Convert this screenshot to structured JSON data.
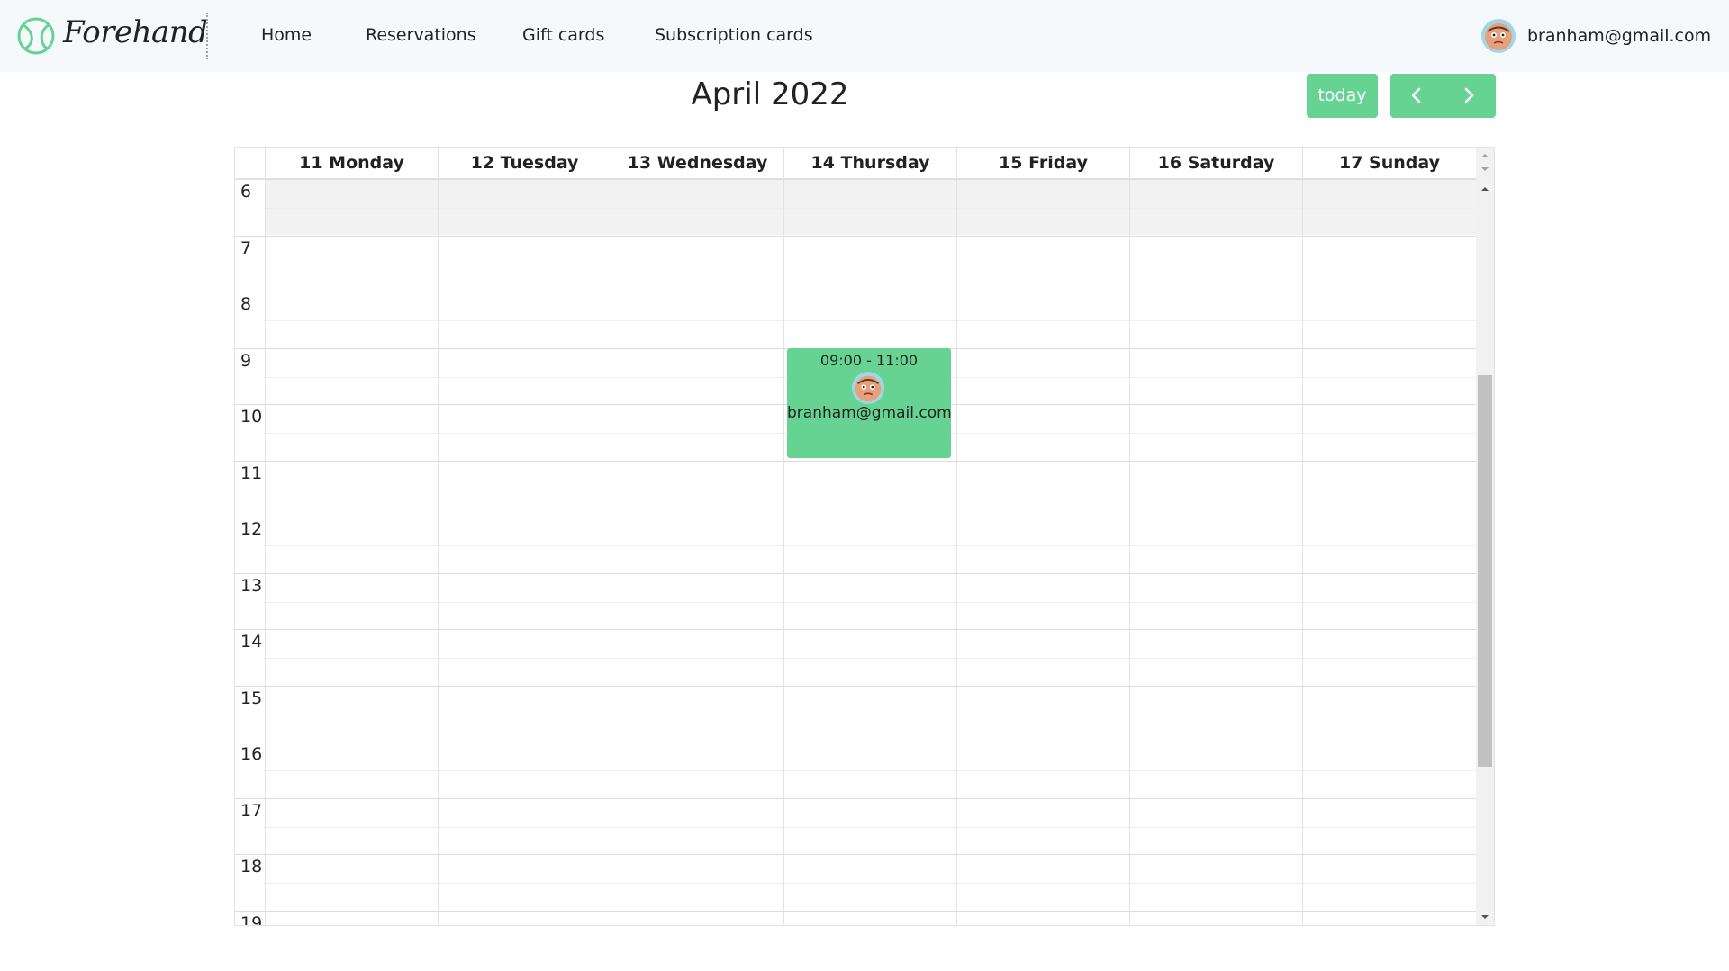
{
  "header": {
    "brand": "Forehand",
    "nav": [
      {
        "label": "Home"
      },
      {
        "label": "Reservations"
      },
      {
        "label": "Gift cards"
      },
      {
        "label": "Subscription cards"
      }
    ],
    "user_email": "branham@gmail.com"
  },
  "calendar": {
    "title": "April 2022",
    "today_label": "today",
    "days": [
      {
        "label": "11 Monday"
      },
      {
        "label": "12 Tuesday"
      },
      {
        "label": "13 Wednesday"
      },
      {
        "label": "14 Thursday"
      },
      {
        "label": "15 Friday"
      },
      {
        "label": "16 Saturday"
      },
      {
        "label": "17 Sunday"
      }
    ],
    "hours": [
      "6",
      "7",
      "8",
      "9",
      "10",
      "11",
      "12",
      "13",
      "14",
      "15",
      "16",
      "17",
      "18",
      "19"
    ],
    "events": [
      {
        "day": "14 Thursday",
        "time": "09:00 - 11:00",
        "email": "branham@gmail.com"
      }
    ]
  },
  "colors": {
    "accent": "#66d393",
    "topbar_bg": "#f5f9fc",
    "past_shade": "#f2f2f2"
  },
  "icons": {
    "logo": "tennis-ball-icon",
    "prev": "chevron-left-icon",
    "next": "chevron-right-icon"
  }
}
